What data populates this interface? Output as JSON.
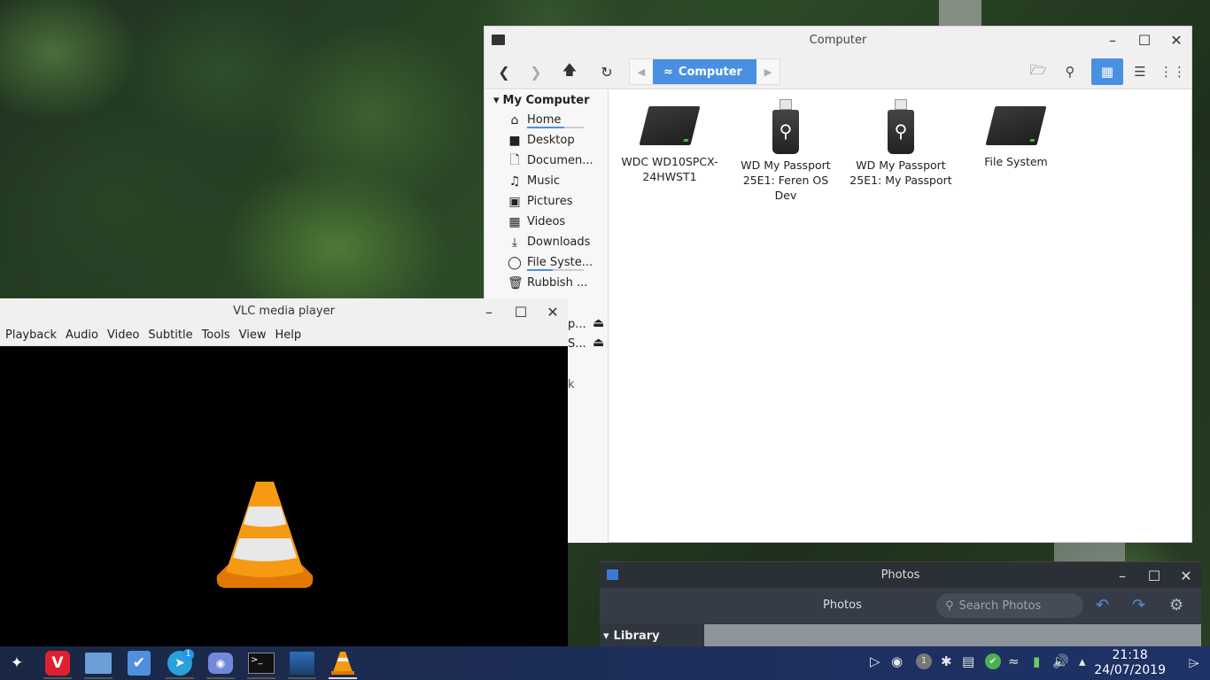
{
  "file_manager": {
    "title": "Computer",
    "breadcrumb": "Computer",
    "sidebar": {
      "heading": "My Computer",
      "items": [
        {
          "label": "Home",
          "icon": "home-icon",
          "usage_percent": 65
        },
        {
          "label": "Desktop",
          "icon": "folder-icon"
        },
        {
          "label": "Documen...",
          "icon": "document-icon"
        },
        {
          "label": "Music",
          "icon": "music-icon"
        },
        {
          "label": "Pictures",
          "icon": "pictures-icon"
        },
        {
          "label": "Videos",
          "icon": "video-icon"
        },
        {
          "label": "Downloads",
          "icon": "download-icon"
        },
        {
          "label": "File Syste...",
          "icon": "filesystem-icon",
          "usage_percent": 45
        },
        {
          "label": "Rubbish ...",
          "icon": "trash-icon"
        }
      ],
      "peek_items": [
        "p...",
        "S...",
        "k"
      ]
    },
    "drives": [
      {
        "label": "WDC WD10SPCX-24HWST1",
        "icon": "hard-drive-icon"
      },
      {
        "label": "WD My Passport 25E1: Feren OS Dev",
        "icon": "usb-drive-icon"
      },
      {
        "label": "WD My Passport 25E1: My Passport",
        "icon": "usb-drive-icon"
      },
      {
        "label": "File System",
        "icon": "hard-drive-icon"
      }
    ]
  },
  "vlc": {
    "title": "VLC media player",
    "menu": [
      "Playback",
      "Audio",
      "Video",
      "Subtitle",
      "Tools",
      "View",
      "Help"
    ]
  },
  "photos": {
    "title": "Photos",
    "toolbar_label": "Photos",
    "search_placeholder": "Search Photos",
    "library_label": "Library"
  },
  "taskbar": {
    "apps": [
      "start-menu",
      "vivaldi",
      "files",
      "store",
      "telegram",
      "discord",
      "terminal",
      "photos",
      "vlc"
    ],
    "telegram_badge": "1",
    "tray_badge": "1",
    "time": "21:18",
    "date": "24/07/2019"
  },
  "colors": {
    "accent": "#4a90e2",
    "vlc_orange": "#f08a00"
  }
}
